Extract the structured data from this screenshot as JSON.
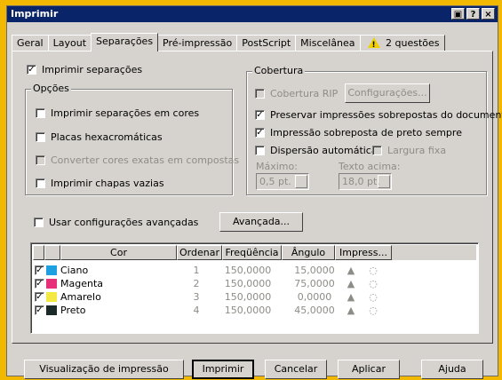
{
  "window": {
    "title": "Imprimir",
    "btn_help": "?",
    "btn_close": "×",
    "btn_extra": "▣"
  },
  "tabs": [
    {
      "label": "Geral"
    },
    {
      "label": "Layout"
    },
    {
      "label": "Separações",
      "active": true
    },
    {
      "label": "Pré-impressão"
    },
    {
      "label": "PostScript"
    },
    {
      "label": "Miscelânea"
    },
    {
      "label": "2 questões",
      "icon": "warning-icon"
    }
  ],
  "main": {
    "print_separations": {
      "label": "Imprimir separações",
      "checked": true
    },
    "options": {
      "title": "Opções",
      "items": [
        {
          "label": "Imprimir separações em cores",
          "checked": false,
          "enabled": true
        },
        {
          "label": "Placas hexacromáticas",
          "checked": false,
          "enabled": true
        },
        {
          "label": "Converter cores exatas em compostas",
          "checked": false,
          "enabled": false
        },
        {
          "label": "Imprimir chapas vazias",
          "checked": false,
          "enabled": true
        }
      ]
    },
    "coverage": {
      "title": "Cobertura",
      "rip": {
        "label": "Cobertura RIP",
        "checked": false,
        "enabled": false
      },
      "config_button": "Configurações...",
      "preserve": {
        "label": "Preservar impressões sobrepostas do documento",
        "checked": true
      },
      "black_overprint": {
        "label": "Impressão sobreposta de preto sempre",
        "checked": true
      },
      "auto_spread": {
        "label": "Dispersão automática",
        "checked": false
      },
      "fixed_width": {
        "label": "Largura fixa",
        "checked": false
      },
      "max_label": "Máximo:",
      "max_value": "0,5 pt.",
      "text_above_label": "Texto acima:",
      "text_above_value": "18,0 pt."
    },
    "advanced": {
      "label": "Usar configurações avançadas",
      "checked": false,
      "button": "Avançada..."
    },
    "table": {
      "headers": [
        "Cor",
        "Ordenar",
        "Freqüência",
        "Ângulo",
        "Impress..."
      ],
      "rows": [
        {
          "name": "Ciano",
          "color": "#1ea0e0",
          "order": "1",
          "freq": "150,0000",
          "angle": "15,0000"
        },
        {
          "name": "Magenta",
          "color": "#e8307a",
          "order": "2",
          "freq": "150,0000",
          "angle": "75,0000"
        },
        {
          "name": "Amarelo",
          "color": "#f4e842",
          "order": "3",
          "freq": "150,0000",
          "angle": "0,0000"
        },
        {
          "name": "Preto",
          "color": "#1b2a28",
          "order": "4",
          "freq": "150,0000",
          "angle": "45,0000"
        }
      ]
    }
  },
  "footer": {
    "preview": "Visualização de impressão",
    "print": "Imprimir",
    "cancel": "Cancelar",
    "apply": "Aplicar",
    "help": "Ajuda"
  }
}
